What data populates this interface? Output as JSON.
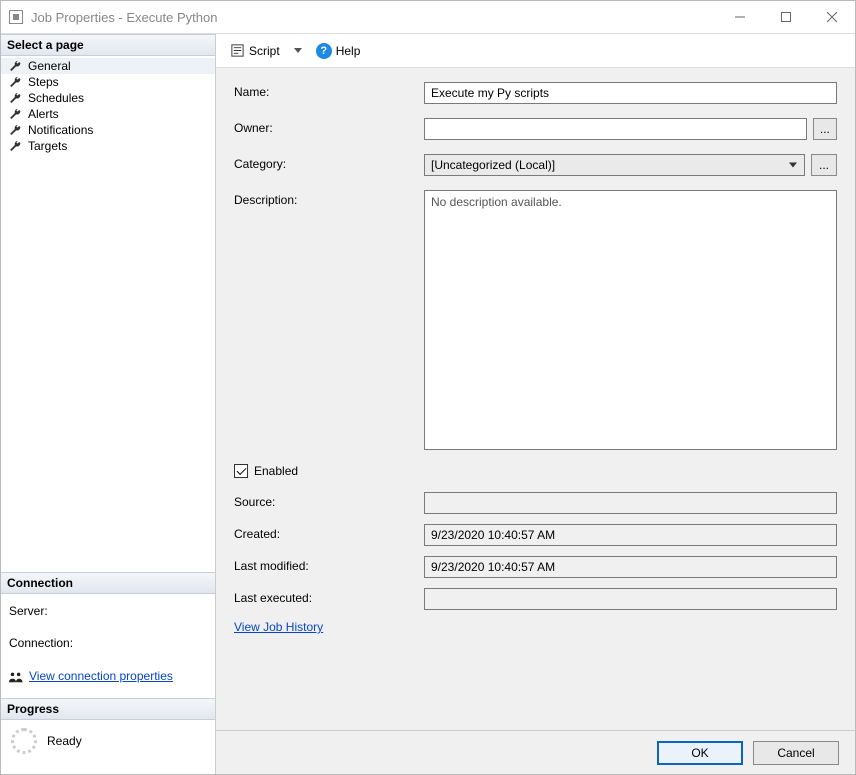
{
  "window": {
    "title": "Job Properties - Execute Python"
  },
  "sidebar": {
    "select_page_header": "Select a page",
    "pages": [
      {
        "label": "General"
      },
      {
        "label": "Steps"
      },
      {
        "label": "Schedules"
      },
      {
        "label": "Alerts"
      },
      {
        "label": "Notifications"
      },
      {
        "label": "Targets"
      }
    ],
    "connection_header": "Connection",
    "server_label": "Server:",
    "server_value": "",
    "connection_label": "Connection:",
    "connection_value": "",
    "view_conn_props": "View connection properties",
    "progress_header": "Progress",
    "progress_status": "Ready"
  },
  "toolbar": {
    "script_label": "Script",
    "help_label": "Help"
  },
  "form": {
    "name_label": "Name:",
    "name_value": "Execute my Py scripts",
    "owner_label": "Owner:",
    "owner_value": "",
    "category_label": "Category:",
    "category_value": "[Uncategorized (Local)]",
    "description_label": "Description:",
    "description_value": "No description available.",
    "enabled_label": "Enabled",
    "enabled_checked": true,
    "source_label": "Source:",
    "source_value": "",
    "created_label": "Created:",
    "created_value": "9/23/2020 10:40:57 AM",
    "last_modified_label": "Last modified:",
    "last_modified_value": "9/23/2020 10:40:57 AM",
    "last_executed_label": "Last executed:",
    "last_executed_value": "",
    "view_history_label": "View Job History"
  },
  "buttons": {
    "ellipsis": "...",
    "ok": "OK",
    "cancel": "Cancel"
  }
}
